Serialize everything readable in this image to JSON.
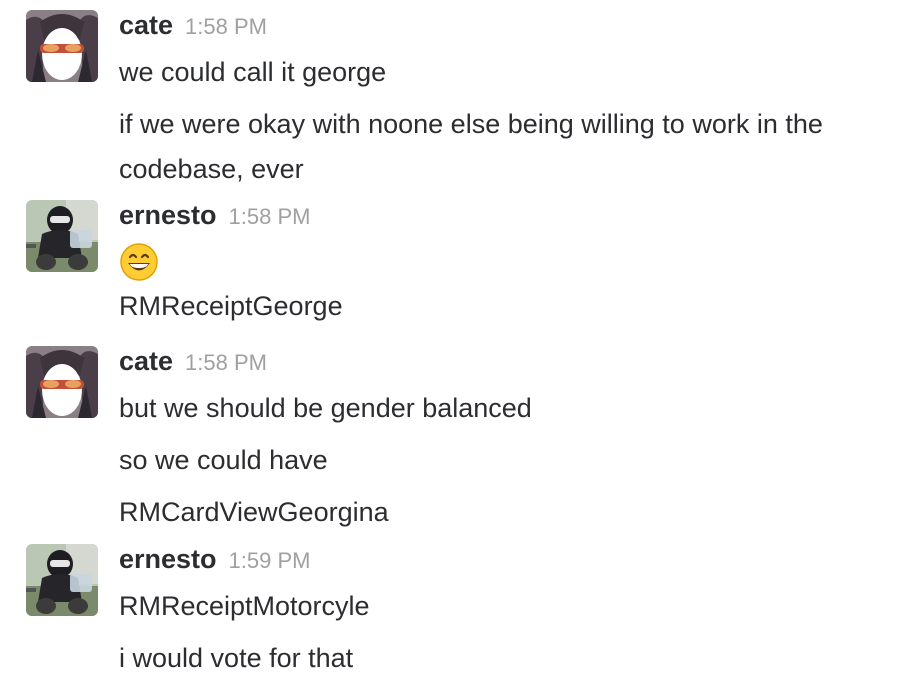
{
  "messages": [
    {
      "author": "cate",
      "time": "1:58 PM",
      "avatar": "cate-avatar",
      "lines": [
        "we could call it george",
        "if we were okay with noone else being willing to work in the codebase, ever"
      ]
    },
    {
      "author": "ernesto",
      "time": "1:58 PM",
      "avatar": "ernesto-avatar",
      "emoji": "grinning-face-emoji",
      "lines": [
        "RMReceiptGeorge"
      ]
    },
    {
      "author": "cate",
      "time": "1:58 PM",
      "avatar": "cate-avatar",
      "lines": [
        "but we should be gender balanced",
        "so we could have",
        "RMCardViewGeorgina"
      ]
    },
    {
      "author": "ernesto",
      "time": "1:59 PM",
      "avatar": "ernesto-avatar",
      "lines": [
        "RMReceiptMotorcyle",
        "i would vote for that"
      ]
    }
  ],
  "colors": {
    "text": "#2c2d30",
    "timestamp": "#a0a0a2",
    "background": "#ffffff"
  }
}
